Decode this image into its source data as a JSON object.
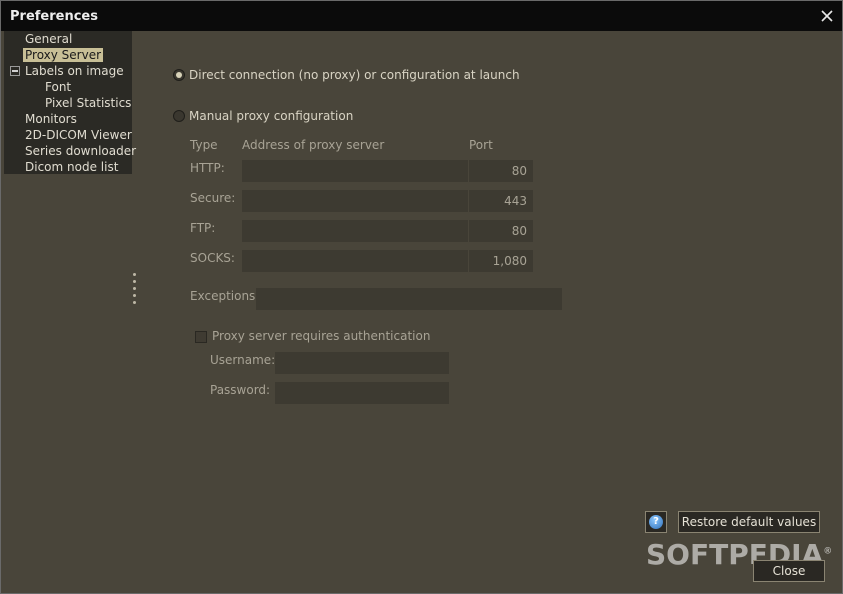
{
  "window": {
    "title": "Preferences"
  },
  "sidebar": {
    "items": [
      {
        "label": "General"
      },
      {
        "label": "Proxy Server"
      },
      {
        "label": "Labels on image"
      },
      {
        "label": "Font"
      },
      {
        "label": "Pixel Statistics"
      },
      {
        "label": "Monitors"
      },
      {
        "label": "2D-DICOM Viewer"
      },
      {
        "label": "Series downloader"
      },
      {
        "label": "Dicom node list"
      }
    ],
    "selected": "Proxy Server"
  },
  "proxy": {
    "direct_label": "Direct connection (no proxy) or configuration at launch",
    "manual_label": "Manual proxy configuration",
    "selected_mode": "direct",
    "headers": {
      "type": "Type",
      "address": "Address of proxy server",
      "port": "Port"
    },
    "rows": [
      {
        "type": "HTTP:",
        "address": "",
        "port": "80"
      },
      {
        "type": "Secure:",
        "address": "",
        "port": "443"
      },
      {
        "type": "FTP:",
        "address": "",
        "port": "80"
      },
      {
        "type": "SOCKS:",
        "address": "",
        "port": "1,080"
      }
    ],
    "exceptions_label": "Exceptions:",
    "exceptions_value": "",
    "auth_label": "Proxy server requires authentication",
    "auth_checked": false,
    "username_label": "Username:",
    "username_value": "",
    "password_label": "Password:",
    "password_value": ""
  },
  "footer": {
    "help_icon": "?",
    "restore_label": "Restore default values",
    "close_label": "Close"
  },
  "watermark": {
    "text": "SOFTPEDIA",
    "mark": "®"
  },
  "colors": {
    "panel_bg": "#49453a",
    "sidebar_bg": "#2b2a25",
    "selection_bg": "#c8bf96",
    "field_bg": "#3d3a31",
    "titlebar_bg": "#0b0b0b"
  }
}
